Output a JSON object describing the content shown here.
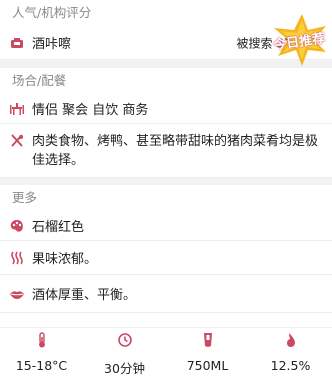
{
  "colors": {
    "accent": "#c94a62",
    "badge_star": "#f6b51d"
  },
  "rating": {
    "section_title": "人气/机构评分",
    "wine_icon": "wine-bottle-icon",
    "wine_name": "酒咔嚓",
    "right_text": "被搜索 3次",
    "badge_text": "今日推荐"
  },
  "occasion": {
    "section_title": "场合/配餐",
    "scene_icon": "dining-table-icon",
    "scene_text": "情侣 聚会 自饮 商务",
    "food_icon": "fork-knife-icon",
    "food_text": "肉类食物、烤鸭、甚至略带甜味的猪肉菜肴均是极佳选择。"
  },
  "more": {
    "section_title": "更多",
    "items": [
      {
        "icon": "palette-icon",
        "text": "石榴红色"
      },
      {
        "icon": "aroma-waves-icon",
        "text": "果味浓郁。"
      },
      {
        "icon": "lips-icon",
        "text": "酒体厚重、平衡。"
      }
    ]
  },
  "stats": [
    {
      "icon": "thermometer-icon",
      "value": "15-18°C"
    },
    {
      "icon": "clock-icon",
      "value": "30分钟"
    },
    {
      "icon": "glass-icon",
      "value": "750ML"
    },
    {
      "icon": "drop-icon",
      "value": "12.5%"
    }
  ]
}
